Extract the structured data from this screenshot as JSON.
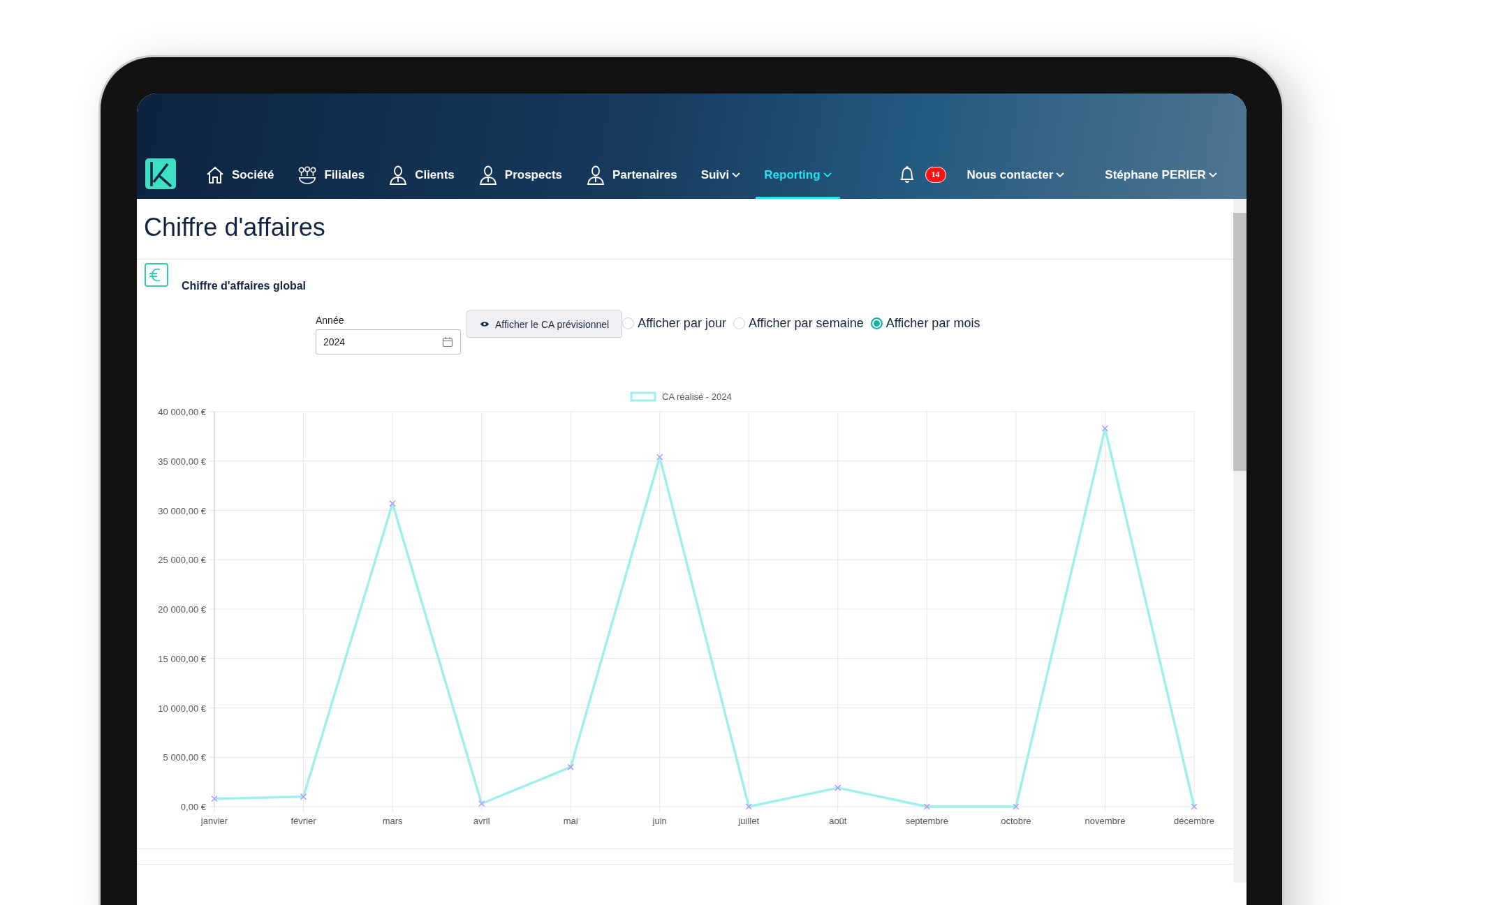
{
  "nav": {
    "items": [
      {
        "label": "Société",
        "selected": false,
        "dropdown": false
      },
      {
        "label": "Filiales",
        "selected": false,
        "dropdown": false
      },
      {
        "label": "Clients",
        "selected": false,
        "dropdown": false
      },
      {
        "label": "Prospects",
        "selected": false,
        "dropdown": false
      },
      {
        "label": "Partenaires",
        "selected": false,
        "dropdown": false
      },
      {
        "label": "Suivi",
        "selected": false,
        "dropdown": true
      },
      {
        "label": "Reporting",
        "selected": true,
        "dropdown": true
      }
    ],
    "notification_count": "14",
    "contact": "Nous contacter",
    "user": "Stéphane PERIER"
  },
  "page_title": "Chiffre d'affaires",
  "card": {
    "title": "Chiffre d'affaires global",
    "year_field": {
      "label": "Année",
      "value": "2024"
    },
    "forecast_button": "Afficher le CA prévisionnel",
    "view_options": [
      {
        "label": "Afficher par jour",
        "selected": false
      },
      {
        "label": "Afficher par semaine",
        "selected": false
      },
      {
        "label": "Afficher par mois",
        "selected": true
      }
    ],
    "chart_data": {
      "type": "line",
      "grid": true,
      "categories": [
        "janvier",
        "février",
        "mars",
        "avril",
        "mai",
        "juin",
        "juillet",
        "août",
        "septembre",
        "octobre",
        "novembre",
        "décembre"
      ],
      "series": [
        {
          "name": "CA réalisé - 2024",
          "color": "#9ef0ec",
          "values": [
            800,
            1000,
            30700,
            300,
            4000,
            35400,
            0,
            1900,
            0,
            0,
            38300,
            0
          ]
        }
      ],
      "ylim": [
        0,
        40000
      ],
      "yticks": [
        {
          "value": 0,
          "label": "0,00 €"
        },
        {
          "value": 5000,
          "label": "5 000,00 €"
        },
        {
          "value": 10000,
          "label": "10 000,00 €"
        },
        {
          "value": 15000,
          "label": "15 000,00 €"
        },
        {
          "value": 20000,
          "label": "20 000,00 €"
        },
        {
          "value": 25000,
          "label": "25 000,00 €"
        },
        {
          "value": 30000,
          "label": "30 000,00 €"
        },
        {
          "value": 35000,
          "label": "35 000,00 €"
        },
        {
          "value": 40000,
          "label": "40 000,00 €"
        }
      ]
    }
  }
}
